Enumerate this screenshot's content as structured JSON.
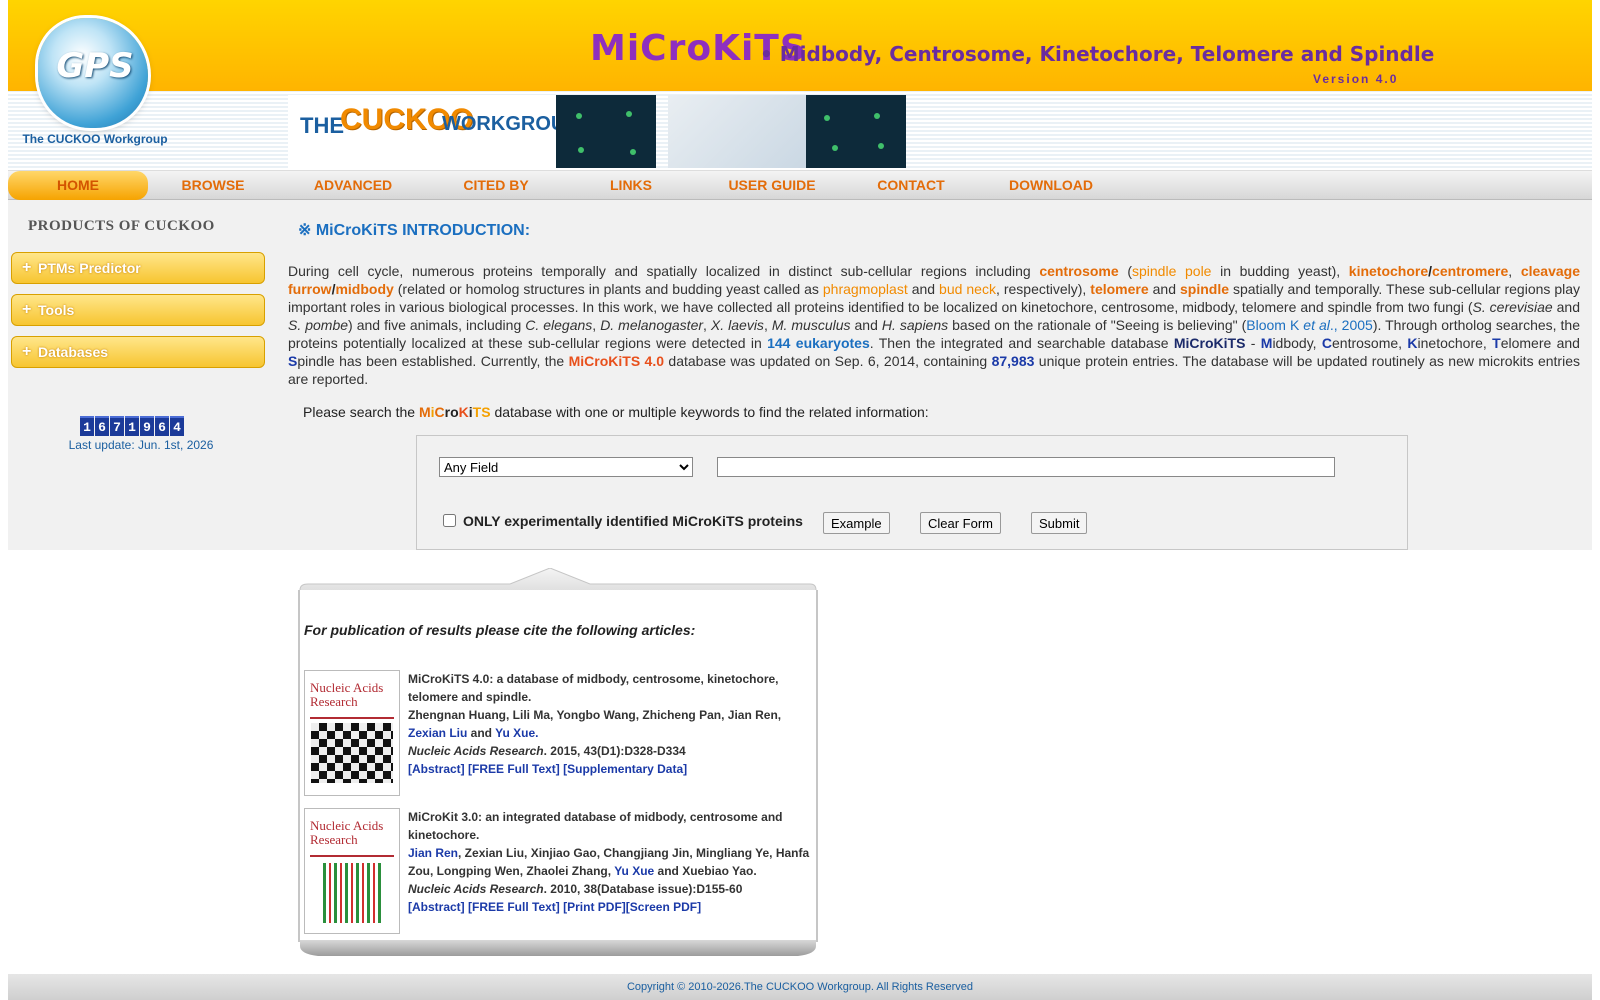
{
  "header": {
    "logo_text": "GPS",
    "logo_caption": "The CUCKOO Workgroup",
    "site_title": "MiCroKiTS",
    "site_subtitle": "• Midbody, Centrosome, Kinetochore, Telomere and Spindle",
    "version": "Version 4.0",
    "banner_the": "THE",
    "banner_cuckoo": "CUCKOO",
    "banner_workgroup": "WORKGROUP"
  },
  "nav": {
    "items": [
      {
        "label": "HOME"
      },
      {
        "label": "BROWSE"
      },
      {
        "label": "ADVANCED"
      },
      {
        "label": "CITED BY"
      },
      {
        "label": "LINKS"
      },
      {
        "label": "USER GUIDE"
      },
      {
        "label": "CONTACT"
      },
      {
        "label": "DOWNLOAD"
      }
    ]
  },
  "sidebar": {
    "products_title": "PRODUCTS OF CUCKOO",
    "buttons": [
      {
        "label": "PTMs Predictor"
      },
      {
        "label": "Tools"
      },
      {
        "label": "Databases"
      }
    ],
    "plus": "+",
    "counter_digits": [
      "1",
      "6",
      "7",
      "1",
      "9",
      "6",
      "4"
    ],
    "last_update": "Last update: Jun. 1st, 2026"
  },
  "main": {
    "intro_title": "※ MiCroKiTS INTRODUCTION:",
    "intro": {
      "p1": "During cell cycle, numerous proteins temporally and spatially localized in distinct sub-cellular regions including ",
      "centrosome": "centrosome",
      "p2": " (",
      "spindle_pole": "spindle pole",
      "p3": " in budding yeast), ",
      "kinetochore": "kinetochore",
      "slash": "/",
      "centromere": "centromere",
      "comma": ", ",
      "cleavage_furrow": "cleavage furrow",
      "midbody": "midbody",
      "p4": " (related or homolog structures in plants and budding yeast called as ",
      "phragmoplast": "phragmoplast",
      "and": " and ",
      "bud_neck": "bud neck",
      "p5": ", respectively), ",
      "telomere": "telomere",
      "spindle": "spindle",
      "p6": " spatially and temporally. These sub-cellular regions play important roles in various biological processes. In this work, we have collected all proteins identified to be localized on kinetochore, centrosome, midbody, telomere and spindle from two fungi (",
      "s_cerevisiae": "S. cerevisiae",
      "s_pombe": "S. pombe",
      "p7": ") and five animals, including ",
      "c_elegans": "C. elegans",
      "d_melanogaster": "D. melanogaster",
      "x_laevis": "X. laevis",
      "m_musculus": "M. musculus",
      "h_sapiens": "H. sapiens",
      "p8": " based on the rationale of \"Seeing is believing\" (",
      "bloom": "Bloom K ",
      "et_al": "et al",
      "year": "., 2005",
      "p9": "). Through ortholog searches, the proteins potentially localized at these sub-cellular regions were detected in ",
      "eukaryotes": "144 eukaryotes",
      "p10": ". Then the integrated and searchable database ",
      "microkits": "MiCroKiTS",
      "dash": " - ",
      "M": "M",
      "idbody": "idbody, ",
      "C": "C",
      "entrosome": "entrosome, ",
      "K": "K",
      "inetochore": "inetochore, ",
      "T": "T",
      "elomere_and": "elomere and ",
      "S": "S",
      "p11": "pindle has been established. Currently, the ",
      "version_name": "MiCroKiTS 4.0",
      "p12": " database was updated on Sep. 6, 2014, containing ",
      "count": "87,983",
      "p13": " unique protein entries. The database will be updated routinely as new microkits entries are reported."
    },
    "search_prompt_pre": "Please search the ",
    "search_name": {
      "M": "M",
      "i": "i",
      "C": "C",
      "ro": "ro",
      "K": "K",
      "i2": "i",
      "TS": "TS"
    },
    "search_prompt_post": " database with one or multiple keywords to find the related information:",
    "field_selected": "Any Field",
    "keyword_value": "",
    "only_label": "ONLY experimentally identified MiCroKiTS proteins",
    "example_btn": "Example",
    "clear_btn": "Clear Form",
    "submit_btn": "Submit"
  },
  "citations": {
    "title": "For publication of results please cite the following articles:",
    "cover_journal": "Nucleic Acids Research",
    "items": [
      {
        "title": "MiCroKiTS 4.0: a database of midbody, centrosome, kinetochore, telomere and spindle.",
        "authors": "Zhengnan Huang, Lili Ma, Yongbo Wang, Zhicheng Pan, Jian Ren,",
        "author_link1": "Zexian Liu",
        "and": " and ",
        "author_link2": "Yu Xue.",
        "journal": "Nucleic Acids Research",
        "ref": ". 2015, 43(D1):D328-D334",
        "links": "[Abstract] [FREE Full Text] [Supplementary Data]"
      },
      {
        "title": "MiCroKit 3.0: an integrated database of midbody, centrosome and kinetochore.",
        "author_link1": "Jian Ren",
        "authors": ", Zexian Liu, Xinjiao Gao, Changjiang Jin, Mingliang Ye, Hanfa Zou, Longping Wen, Zhaolei Zhang, ",
        "author_link2": "Yu Xue",
        "authors_end": " and Xuebiao Yao.",
        "journal": "Nucleic Acids Research",
        "ref": ". 2010, 38(Database issue):D155-60",
        "links": "[Abstract] [FREE Full Text] [Print PDF][Screen PDF]"
      }
    ]
  },
  "footer": {
    "copyright": "Copyright © 2010-2026.The CUCKOO Workgroup. All Rights Reserved"
  },
  "colors": {
    "accent_orange": "#e36c09",
    "header_yellow": "#ffc800",
    "link_blue": "#1b3aa8",
    "title_purple": "#8e2fbf"
  }
}
